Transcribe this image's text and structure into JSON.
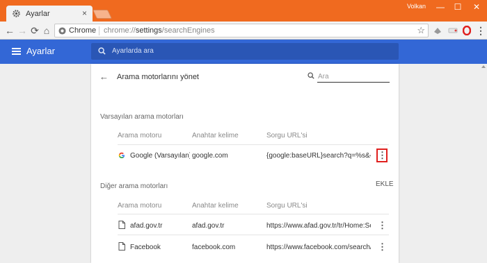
{
  "window": {
    "tab_title": "Ayarlar",
    "tab_close": "×",
    "user_name": "Volkan",
    "minimize": "—",
    "maximize": "☐",
    "close": "✕"
  },
  "toolbar": {
    "back": "←",
    "forward": "→",
    "reload": "⟳",
    "home": "⌂",
    "omnibox_label": "Chrome",
    "url_prefix": "chrome://",
    "url_path": "settings",
    "url_rest": "/searchEngines",
    "star": "☆"
  },
  "header": {
    "title": "Ayarlar",
    "search_placeholder": "Ayarlarda ara",
    "color": "#3367d6"
  },
  "page": {
    "back": "←",
    "title": "Arama motorlarını yönet",
    "search_placeholder": "Ara"
  },
  "default_section": {
    "heading": "Varsayılan arama motorları",
    "columns": [
      "Arama motoru",
      "Anahtar kelime",
      "Sorgu URL'si"
    ],
    "rows": [
      {
        "name": "Google (Varsayılan)",
        "keyword": "google.com",
        "url": "{google:baseURL}search?q=%s&{go...",
        "menu": "⋮"
      }
    ]
  },
  "other_section": {
    "heading": "Diğer arama motorları",
    "add_label": "EKLE",
    "columns": [
      "Arama motoru",
      "Anahtar kelime",
      "Sorgu URL'si"
    ],
    "rows": [
      {
        "name": "afad.gov.tr",
        "keyword": "afad.gov.tr",
        "url": "https://www.afad.gov.tr/tr/Home:Se...",
        "menu": "⋮"
      },
      {
        "name": "Facebook",
        "keyword": "facebook.com",
        "url": "https://www.facebook.com/search/...",
        "menu": "⋮"
      }
    ]
  },
  "colors": {
    "titlebar": "#f06a1f",
    "highlight": "#e0201e"
  }
}
